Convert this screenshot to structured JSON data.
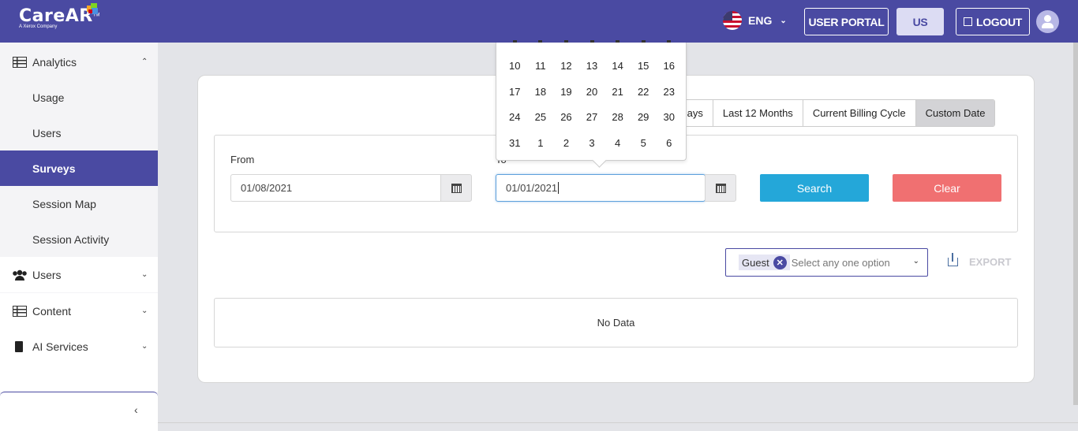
{
  "header": {
    "brand": "CareAR",
    "brand_sub": "A Xerox Company",
    "language": "ENG",
    "user_portal_label": "USER PORTAL",
    "region_label": "US",
    "logout_label": "LOGOUT"
  },
  "sidebar": {
    "items": [
      {
        "label": "Analytics",
        "icon": "table-icon"
      },
      {
        "label": "Usage"
      },
      {
        "label": "Users"
      },
      {
        "label": "Surveys"
      },
      {
        "label": "Session Map"
      },
      {
        "label": "Session Activity"
      },
      {
        "label": "Users",
        "icon": "users-icon"
      },
      {
        "label": "Content",
        "icon": "table-icon"
      },
      {
        "label": "AI Services",
        "icon": "chip-icon"
      }
    ],
    "collapse_label": "‹"
  },
  "tabs": [
    "t 30 Days",
    "Last 12 Months",
    "Current Billing Cycle",
    "Custom Date"
  ],
  "filter": {
    "from_label": "From",
    "to_label": "To",
    "from_value": "01/08/2021",
    "to_value": "01/01/2021",
    "search_label": "Search",
    "clear_label": "Clear"
  },
  "calendar": {
    "rows": [
      [
        "10",
        "11",
        "12",
        "13",
        "14",
        "15",
        "16"
      ],
      [
        "17",
        "18",
        "19",
        "20",
        "21",
        "22",
        "23"
      ],
      [
        "24",
        "25",
        "26",
        "27",
        "28",
        "29",
        "30"
      ],
      [
        "31",
        "1",
        "2",
        "3",
        "4",
        "5",
        "6"
      ]
    ]
  },
  "select": {
    "tag": "Guest",
    "placeholder": "Select any one option"
  },
  "export_label": "EXPORT",
  "table": {
    "empty_text": "No Data"
  },
  "colors": {
    "primary": "#4a4aa2",
    "search": "#24a7d9",
    "clear": "#f07071"
  }
}
